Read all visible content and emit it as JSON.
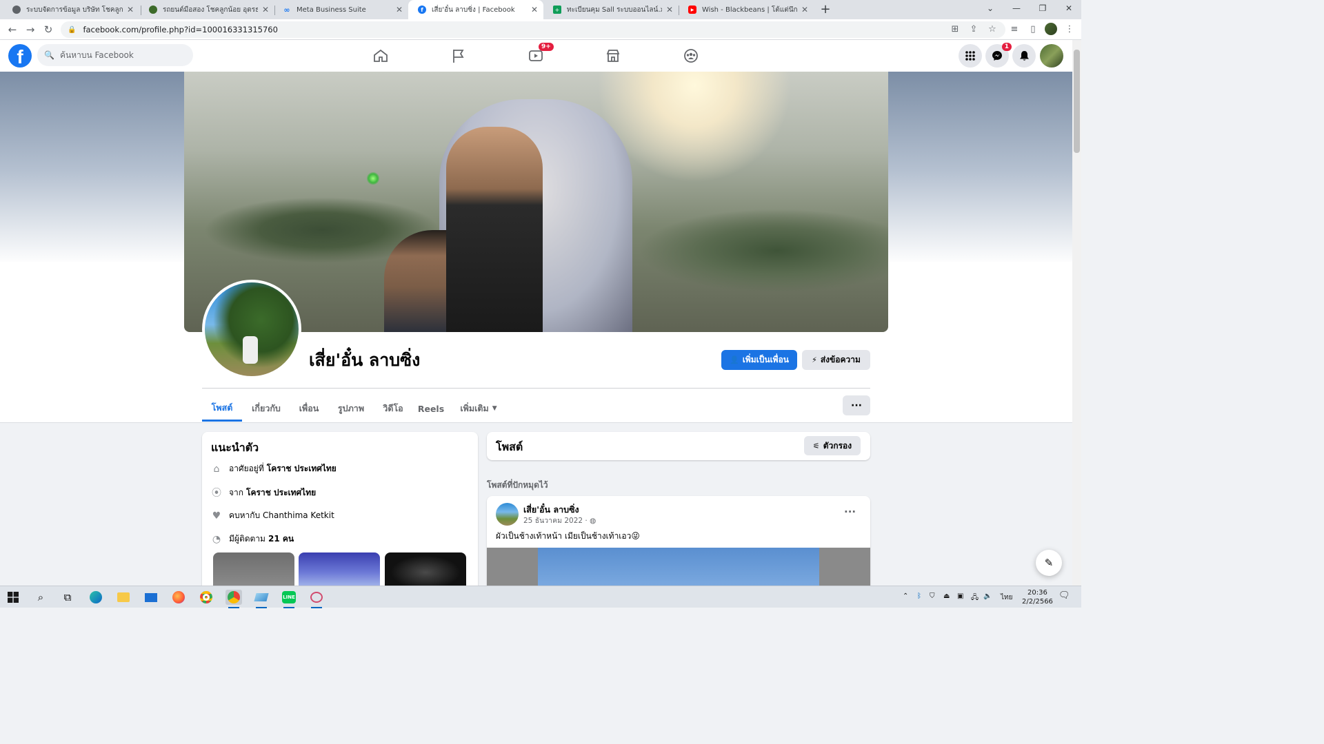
{
  "browser": {
    "tabs": [
      {
        "title": "ระบบจัดการข้อมูล บริษัท โชคลูกน้อย อุดรธานี",
        "color": "#5f6368"
      },
      {
        "title": "รถยนต์มือสอง โชคลูกน้อย อุดรธานี",
        "color": "#3d6b2a"
      },
      {
        "title": "Meta Business Suite",
        "color": "#1877f2"
      },
      {
        "title": "เสี่ย'อั๋น ลาบซิ่ง | Facebook",
        "color": "#1877f2"
      },
      {
        "title": "ทะเบียนคุม Sall ระบบออนไลน์.xlsx - G",
        "color": "#0f9d58"
      },
      {
        "title": "Wish - Blackbeans | โต้แต่นึกถึง, โต้",
        "color": "#ff0000"
      }
    ],
    "url": "facebook.com/profile.php?id=100016331315760"
  },
  "facebook": {
    "search_placeholder": "ค้นหาบน Facebook",
    "watch_badge": "9+",
    "messenger_badge": "1",
    "profile_name": "เสี่ย'อั๋น ลาบซิ่ง",
    "add_friend_label": "เพิ่มเป็นเพื่อน",
    "message_label": "ส่งข้อความ",
    "profile_tabs": [
      "โพสต์",
      "เกี่ยวกับ",
      "เพื่อน",
      "รูปภาพ",
      "วิดีโอ",
      "Reels",
      "เพิ่มเติม"
    ],
    "intro": {
      "title": "แนะนำตัว",
      "lives_prefix": "อาศัยอยู่ที่",
      "lives_value": "โคราช ประเทศไทย",
      "from_prefix": "จาก",
      "from_value": "โคราช ประเทศไทย",
      "relationship": "คบหากับ Chanthima Ketkit",
      "followers_prefix": "มีผู้ติดตาม",
      "followers_value": "21 คน"
    },
    "posts": {
      "title": "โพสต์",
      "filter_label": "ตัวกรอง",
      "pinned_label": "โพสต์ที่ปักหมุดไว้",
      "author": "เสี่ย'อั๋น ลาบซิ่ง",
      "date": "25 ธันวาคม 2022 · ",
      "text": "ผัวเป็นช้างเท้าหน้า เมียเป็นช้างเท้าเอว😜"
    }
  },
  "taskbar": {
    "language": "ไทย",
    "time": "20:36",
    "date": "2/2/2566"
  }
}
